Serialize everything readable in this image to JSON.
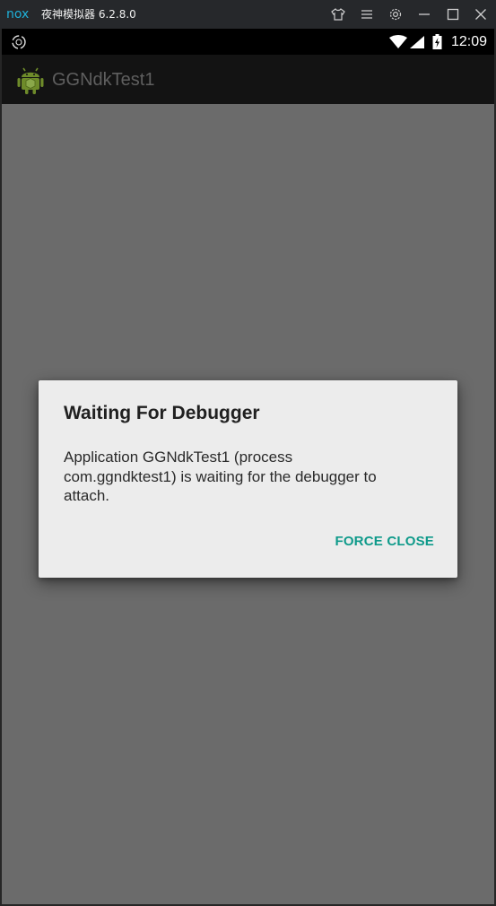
{
  "window": {
    "logo_text": "nox",
    "title": "夜神模拟器 6.2.8.0",
    "controls": [
      "shirt-icon",
      "menu-icon",
      "gear-icon",
      "minimize-icon",
      "maximize-icon",
      "close-icon"
    ]
  },
  "statusbar": {
    "time": "12:09",
    "icons": [
      "nox-status-icon",
      "wifi-icon",
      "signal-icon",
      "battery-icon"
    ]
  },
  "actionbar": {
    "app_title": "GGNdkTest1",
    "app_icon": "android-icon"
  },
  "dialog": {
    "title": "Waiting For Debugger",
    "message": "Application GGNdkTest1 (process\ncom.ggndktest1) is waiting for the debugger to\nattach.",
    "button_label": "FORCE CLOSE",
    "button_color": "#0e9a8a"
  },
  "colors": {
    "titlebar": "#26282b",
    "scrim": "#6b6b6b",
    "dialog_bg": "#ececec",
    "nox_accent": "#1fb0d8"
  }
}
